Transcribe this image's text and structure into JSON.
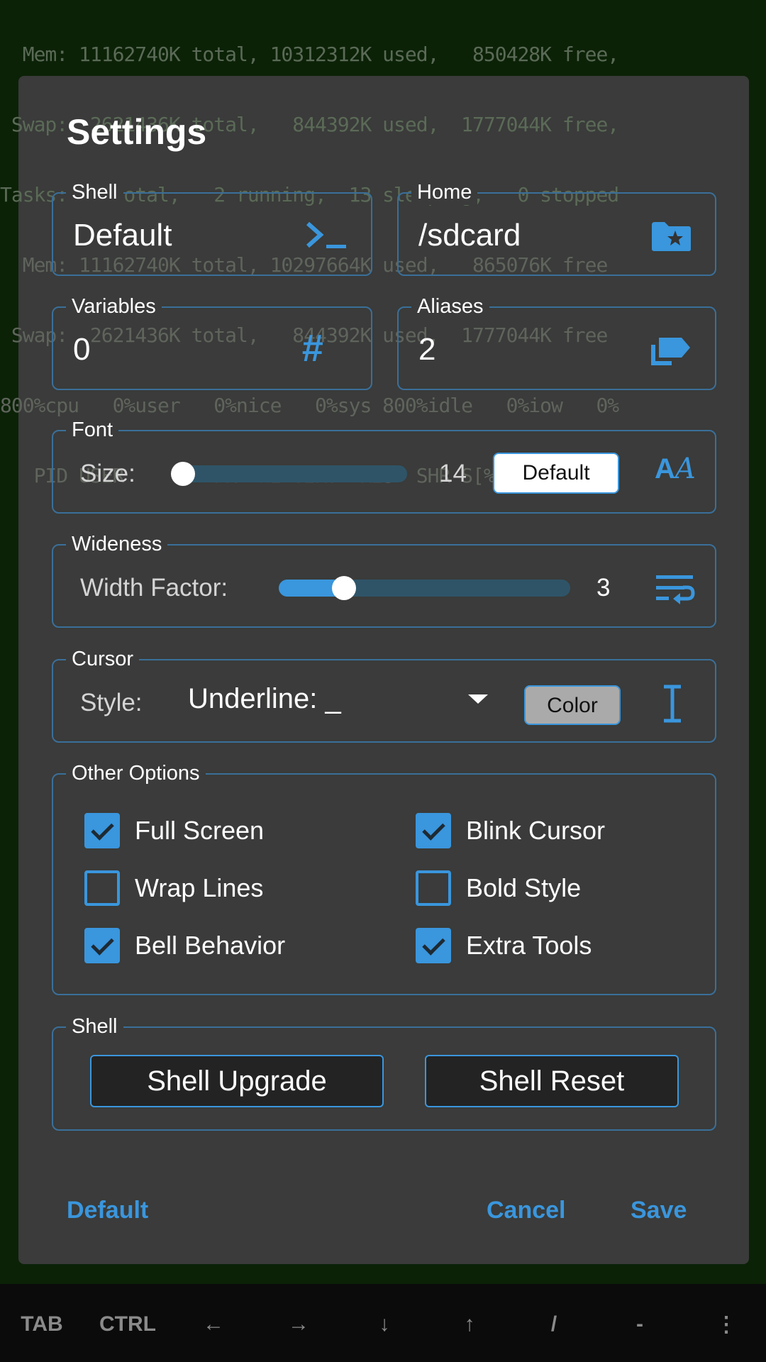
{
  "terminal": {
    "lines": [
      "  Mem: 11162740K total, 10312312K used,   850428K free,",
      " Swap:  2621436K total,   844392K used,  1777044K free,",
      "Tasks: 15 total,   2 running,  13 sleeping,   0 stopped",
      "  Mem: 11162740K total, 10297664K used,   865076K free",
      " Swap:  2621436K total,   844392K used,  1777044K free",
      "800%cpu   0%user   0%nice   0%sys 800%idle   0%iow   0%",
      "   PID USER        PR  NI VIRT  RES  SHR S[%CPU] %MEM"
    ]
  },
  "dialog": {
    "title": "Settings",
    "shell": {
      "label": "Shell",
      "value": "Default",
      "icon": "terminal-prompt-icon"
    },
    "home": {
      "label": "Home",
      "value": "/sdcard",
      "icon": "folder-star-icon"
    },
    "variables": {
      "label": "Variables",
      "value": "0",
      "icon": "hash-icon"
    },
    "aliases": {
      "label": "Aliases",
      "value": "2",
      "icon": "label-copy-icon"
    },
    "font": {
      "label": "Font",
      "size_label": "Size:",
      "size_value": "14",
      "slider_fraction": 0.0,
      "default_button": "Default",
      "icon": "font-size-icon"
    },
    "wideness": {
      "label": "Wideness",
      "width_label": "Width Factor:",
      "width_value": "3",
      "slider_fraction": 0.22,
      "icon": "wrap-text-icon"
    },
    "cursor": {
      "label": "Cursor",
      "style_label": "Style:",
      "style_value": "Underline: _",
      "color_button": "Color",
      "icon": "text-cursor-icon"
    },
    "other": {
      "label": "Other Options",
      "options": [
        {
          "label": "Full Screen",
          "checked": true
        },
        {
          "label": "Blink Cursor",
          "checked": true
        },
        {
          "label": "Wrap Lines",
          "checked": false
        },
        {
          "label": "Bold Style",
          "checked": false
        },
        {
          "label": "Bell Behavior",
          "checked": true
        },
        {
          "label": "Extra Tools",
          "checked": true
        }
      ]
    },
    "shell_group": {
      "label": "Shell",
      "upgrade": "Shell Upgrade",
      "reset": "Shell Reset"
    },
    "footer": {
      "default": "Default",
      "cancel": "Cancel",
      "save": "Save"
    }
  },
  "keys": [
    "TAB",
    "CTRL",
    "←",
    "→",
    "↓",
    "↑",
    "/",
    "-",
    "⋮"
  ],
  "colors": {
    "accent": "#3a96dd",
    "background": "#0b2207",
    "dialog": "#3a3b3a"
  }
}
